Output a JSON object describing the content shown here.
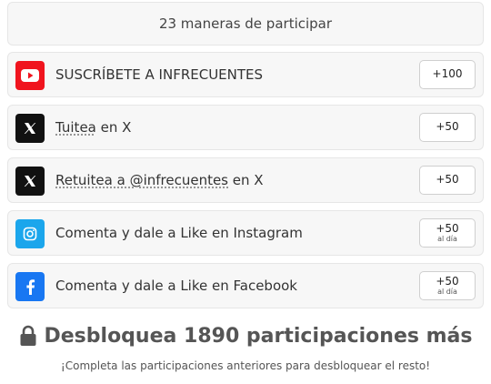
{
  "header": {
    "title": "23 maneras de participar"
  },
  "entries": [
    {
      "icon": "youtube-icon",
      "parts": [
        "SUSCRÍBETE A INFRECUENTES"
      ],
      "points": "+100",
      "sub": ""
    },
    {
      "icon": "x-icon",
      "parts": [
        "Tuitea",
        " en X"
      ],
      "points": "+50",
      "sub": ""
    },
    {
      "icon": "x-icon",
      "parts": [
        "Retuitea a @infrecuentes",
        " en X"
      ],
      "points": "+50",
      "sub": ""
    },
    {
      "icon": "instagram-icon",
      "parts": [
        "Comenta y dale a Like en Instagram"
      ],
      "points": "+50",
      "sub": "al día"
    },
    {
      "icon": "facebook-icon",
      "parts": [
        "Comenta y dale a Like en Facebook"
      ],
      "points": "+50",
      "sub": "al día"
    }
  ],
  "unlock": {
    "text": "Desbloquea 1890 participaciones más"
  },
  "footer": {
    "text": "¡Completa las participaciones anteriores para desbloquear el resto!"
  },
  "colors": {
    "youtube": "#f0141e",
    "x": "#111111",
    "instagram": "#1ba6ec",
    "facebook": "#1877f2"
  }
}
